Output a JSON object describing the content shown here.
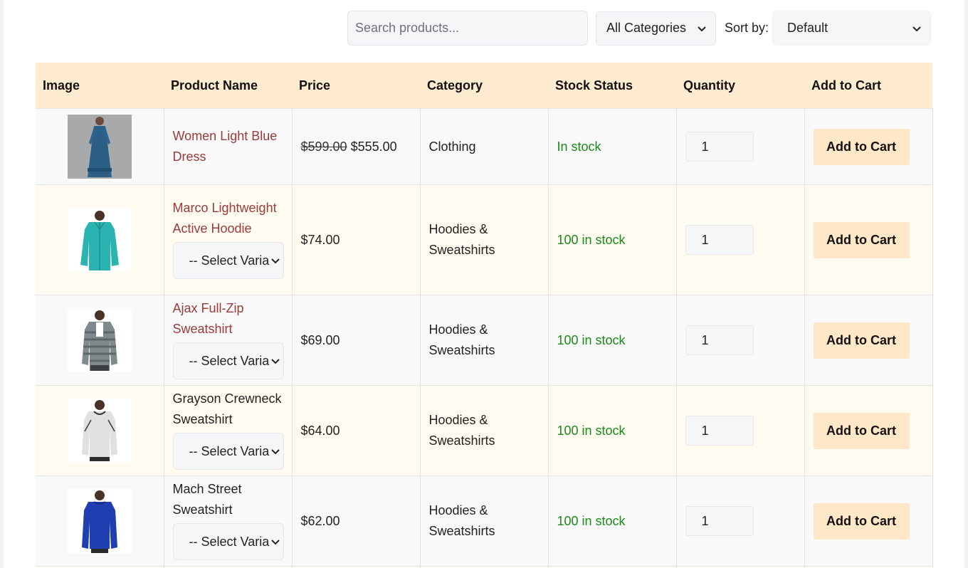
{
  "toolbar": {
    "search_placeholder": "Search products...",
    "category_value": "All Categories",
    "sort_label": "Sort by:",
    "sort_value": "Default"
  },
  "columns": [
    "Image",
    "Product Name",
    "Price",
    "Category",
    "Stock Status",
    "Quantity",
    "Add to Cart"
  ],
  "products": [
    {
      "name": "Women Light Blue Dress",
      "name_linked": true,
      "old_price": "$599.00",
      "price": "$555.00",
      "category": "Clothing",
      "stock": "In stock",
      "quantity": "1",
      "button": "Add to Cart",
      "variation": null,
      "image_icon": "dress-image"
    },
    {
      "name": "Marco Lightweight Active Hoodie",
      "name_linked": true,
      "price": "$74.00",
      "category": "Hoodies & Sweatshirts",
      "stock": "100 in stock",
      "quantity": "1",
      "button": "Add to Cart",
      "variation": "-- Select Varia",
      "image_icon": "teal-hoodie-image"
    },
    {
      "name": "Ajax Full-Zip Sweatshirt",
      "name_linked": true,
      "price": "$69.00",
      "category": "Hoodies & Sweatshirts",
      "stock": "100 in stock",
      "quantity": "1",
      "button": "Add to Cart",
      "variation": "-- Select Varia",
      "image_icon": "striped-sweatshirt-image"
    },
    {
      "name": "Grayson Crewneck Sweatshirt",
      "name_linked": false,
      "price": "$64.00",
      "category": "Hoodies & Sweatshirts",
      "stock": "100 in stock",
      "quantity": "1",
      "button": "Add to Cart",
      "variation": "-- Select Varia",
      "image_icon": "gray-crewneck-image"
    },
    {
      "name": "Mach Street Sweatshirt",
      "name_linked": false,
      "price": "$62.00",
      "category": "Hoodies & Sweatshirts",
      "stock": "100 in stock",
      "quantity": "1",
      "button": "Add to Cart",
      "variation": "-- Select Varia",
      "image_icon": "blue-sweatshirt-image"
    }
  ],
  "colors": {
    "header_bg": "#ffecd0",
    "link": "#9a3b3b",
    "stock": "#1b8a1b",
    "button_bg": "#ffe7c7"
  }
}
